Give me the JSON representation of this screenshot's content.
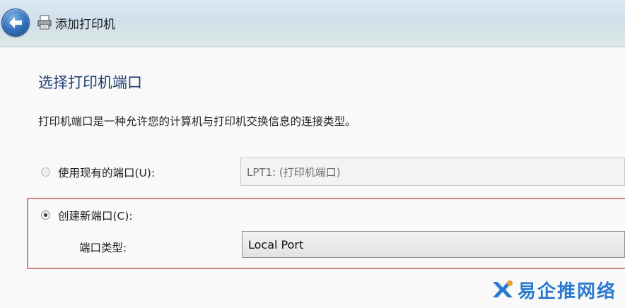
{
  "window": {
    "title": "添加打印机"
  },
  "page": {
    "heading": "选择打印机端口",
    "description": "打印机端口是一种允许您的计算机与打印机交换信息的连接类型。"
  },
  "options": {
    "existing_port": {
      "label": "使用现有的端口(U):",
      "value": "LPT1: (打印机端口)",
      "selected": false
    },
    "new_port": {
      "label": "创建新端口(C):",
      "selected": true,
      "type_label": "端口类型:",
      "type_value": "Local Port"
    }
  },
  "watermark": {
    "text": "易企推网络"
  },
  "colors": {
    "heading": "#1f3d70",
    "highlight_border": "#d77f83",
    "watermark": "#2a7bcf"
  },
  "icons": [
    "back-arrow-icon",
    "printer-icon",
    "radio-button"
  ]
}
